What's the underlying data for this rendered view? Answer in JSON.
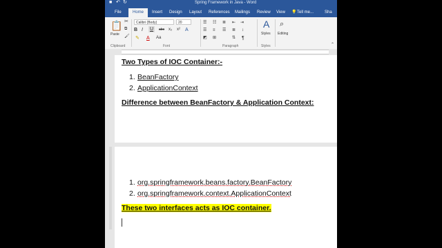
{
  "window": {
    "title": "Spring Framework in Java - Word",
    "qat_icons": [
      "save-icon",
      "undo-icon",
      "redo-icon"
    ]
  },
  "tabs": [
    "File",
    "Home",
    "Insert",
    "Design",
    "Layout",
    "References",
    "Mailings",
    "Review",
    "View"
  ],
  "tell_me": "Tell me...",
  "share": "Sha",
  "ribbon": {
    "clipboard": {
      "paste_label": "Paste",
      "group_label": "Clipboard"
    },
    "font": {
      "font_name": "Calibri (Body)",
      "font_size": "20",
      "bold": "B",
      "italic": "I",
      "underline": "U",
      "strikethrough": "abc",
      "subscript": "x₂",
      "superscript": "x²",
      "group_label": "Font"
    },
    "paragraph": {
      "group_label": "Paragraph"
    },
    "styles": {
      "label": "Styles",
      "group_label": "Styles"
    },
    "editing": {
      "label": "Editing"
    }
  },
  "document": {
    "heading1": "Two Types of IOC Container:-",
    "list1": [
      {
        "num": "1.",
        "text": "BeanFactory"
      },
      {
        "num": "2.",
        "text": "ApplicationContext"
      }
    ],
    "heading2": "Difference between BeanFactory & Application Context:",
    "list2": [
      {
        "num": "1.",
        "text": "org.springframework.beans.factory.BeanFactory"
      },
      {
        "num": "2.",
        "text": "org.springframework.context.ApplicationContext"
      }
    ],
    "highlight_line": "These two interfaces acts as IOC container."
  },
  "colors": {
    "word_blue": "#2b579a",
    "highlight": "#ffff00"
  }
}
